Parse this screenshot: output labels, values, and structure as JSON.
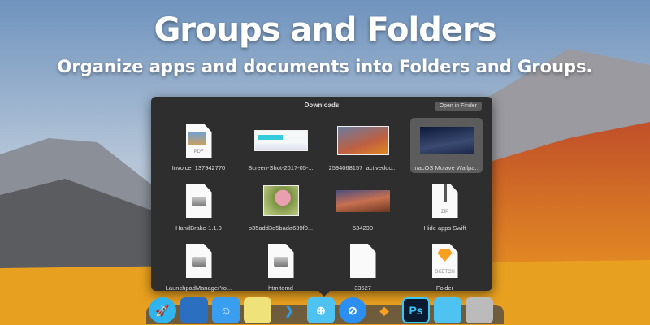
{
  "hero": {
    "title": "Groups and Folders",
    "subtitle": "Organize apps and documents into Folders and Groups."
  },
  "panel": {
    "title": "Downloads",
    "open_button": "Open in Finder",
    "items": [
      {
        "label": "Invoice_137942770",
        "kind": "pdf",
        "badge": "PDF"
      },
      {
        "label": "Screen-Shot-2017-05-...",
        "kind": "screenshot"
      },
      {
        "label": "2594068157_activedoc...",
        "kind": "sierra"
      },
      {
        "label": "macOS Mojave Wallpa...",
        "kind": "mojave-night",
        "selected": true
      },
      {
        "label": "HandBrake-1.1.0",
        "kind": "dmg"
      },
      {
        "label": "b35add3d5bada639f0...",
        "kind": "photo"
      },
      {
        "label": "534230",
        "kind": "mojave-day"
      },
      {
        "label": "Hide apps Swift",
        "kind": "zip",
        "badge": "ZIP"
      },
      {
        "label": "LaunchpadManagerYo...",
        "kind": "dmg"
      },
      {
        "label": "htmltomd",
        "kind": "dmg"
      },
      {
        "label": "33527",
        "kind": "blank"
      },
      {
        "label": "Folder",
        "kind": "sketch",
        "badge": "SKETCH"
      }
    ]
  },
  "dock": [
    {
      "name": "rocket",
      "bg": "#2fb4f0",
      "glyph": "🚀"
    },
    {
      "name": "launchpad-manager",
      "bg": "#2a6fc0",
      "glyph": ""
    },
    {
      "name": "finder",
      "bg": "#3a9ef0",
      "glyph": "☺"
    },
    {
      "name": "notes",
      "bg": "#efe27a",
      "glyph": ""
    },
    {
      "name": "prompt",
      "bg": "transparent",
      "glyph": "❯"
    },
    {
      "name": "downloads-folder",
      "bg": "#4ec3f2",
      "glyph": "⊕"
    },
    {
      "name": "safari",
      "bg": "#2a8ff0",
      "glyph": "⊘"
    },
    {
      "name": "sketch",
      "bg": "transparent",
      "glyph": "◆"
    },
    {
      "name": "photoshop",
      "bg": "#0a1a30",
      "glyph": "Ps"
    },
    {
      "name": "folder",
      "bg": "#4ec3f2",
      "glyph": ""
    },
    {
      "name": "trash",
      "bg": "#bbb",
      "glyph": ""
    }
  ]
}
